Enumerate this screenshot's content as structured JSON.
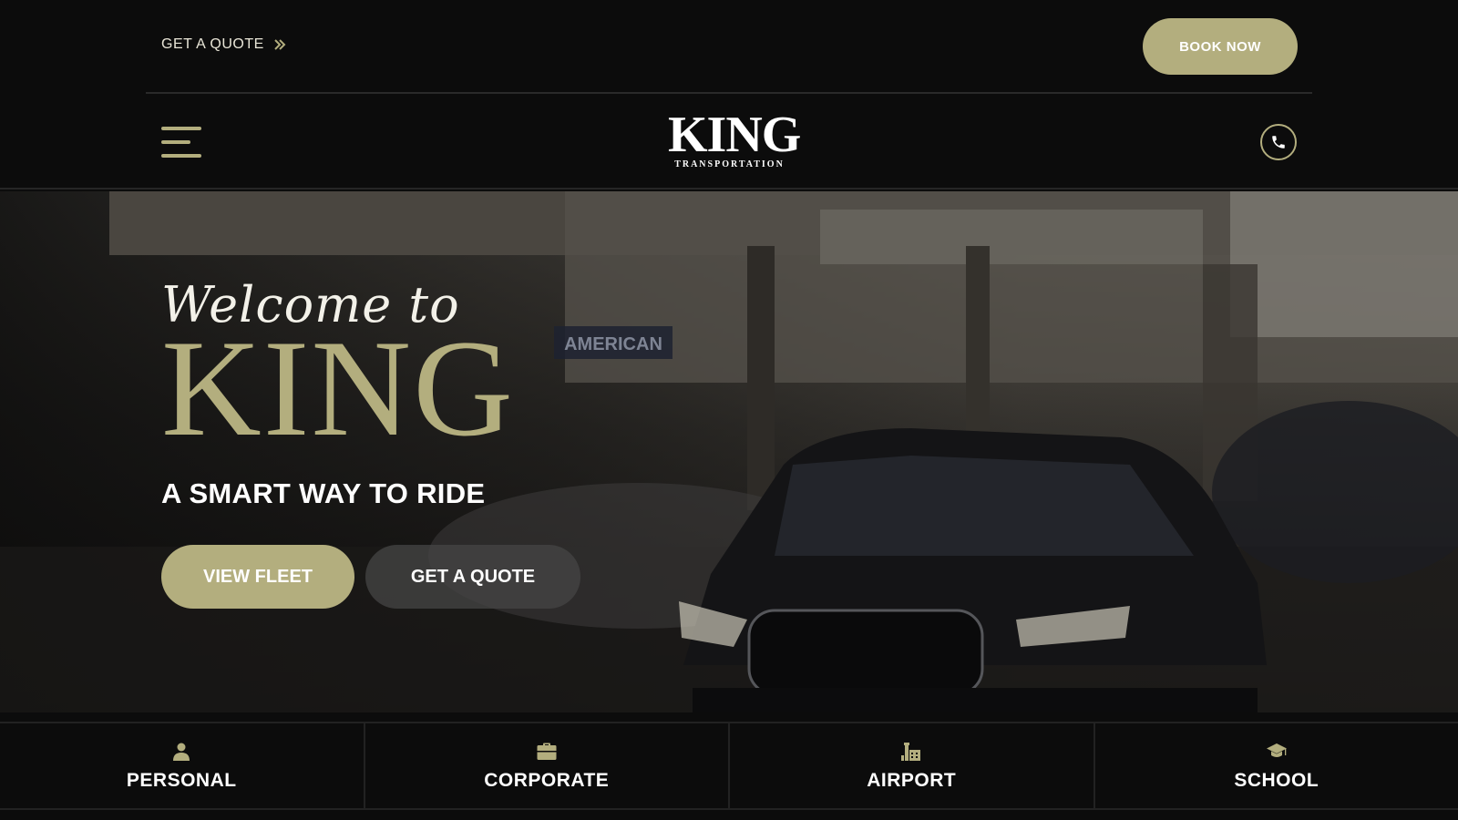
{
  "topbar": {
    "quote_label": "GET A QUOTE",
    "quote_icon": "double-chevron-right-icon",
    "book_label": "BOOK NOW"
  },
  "navbar": {
    "menu_icon": "hamburger-menu-icon",
    "logo_main": "KING",
    "logo_sub": "TRANSPORTATION",
    "phone_icon": "phone-icon"
  },
  "hero": {
    "welcome": "Welcome to",
    "brand": "KING",
    "tagline": "A SMART WAY TO RIDE",
    "primary_button": "VIEW FLEET",
    "secondary_button": "GET A QUOTE",
    "background_sign": "AMERICAN"
  },
  "services": [
    {
      "label": "PERSONAL",
      "icon": "person-icon"
    },
    {
      "label": "CORPORATE",
      "icon": "briefcase-icon"
    },
    {
      "label": "AIRPORT",
      "icon": "airport-tower-icon"
    },
    {
      "label": "SCHOOL",
      "icon": "graduation-cap-icon"
    }
  ],
  "colors": {
    "accent": "#b3ae7e",
    "background": "#0c0c0c",
    "text": "#ffffff"
  }
}
